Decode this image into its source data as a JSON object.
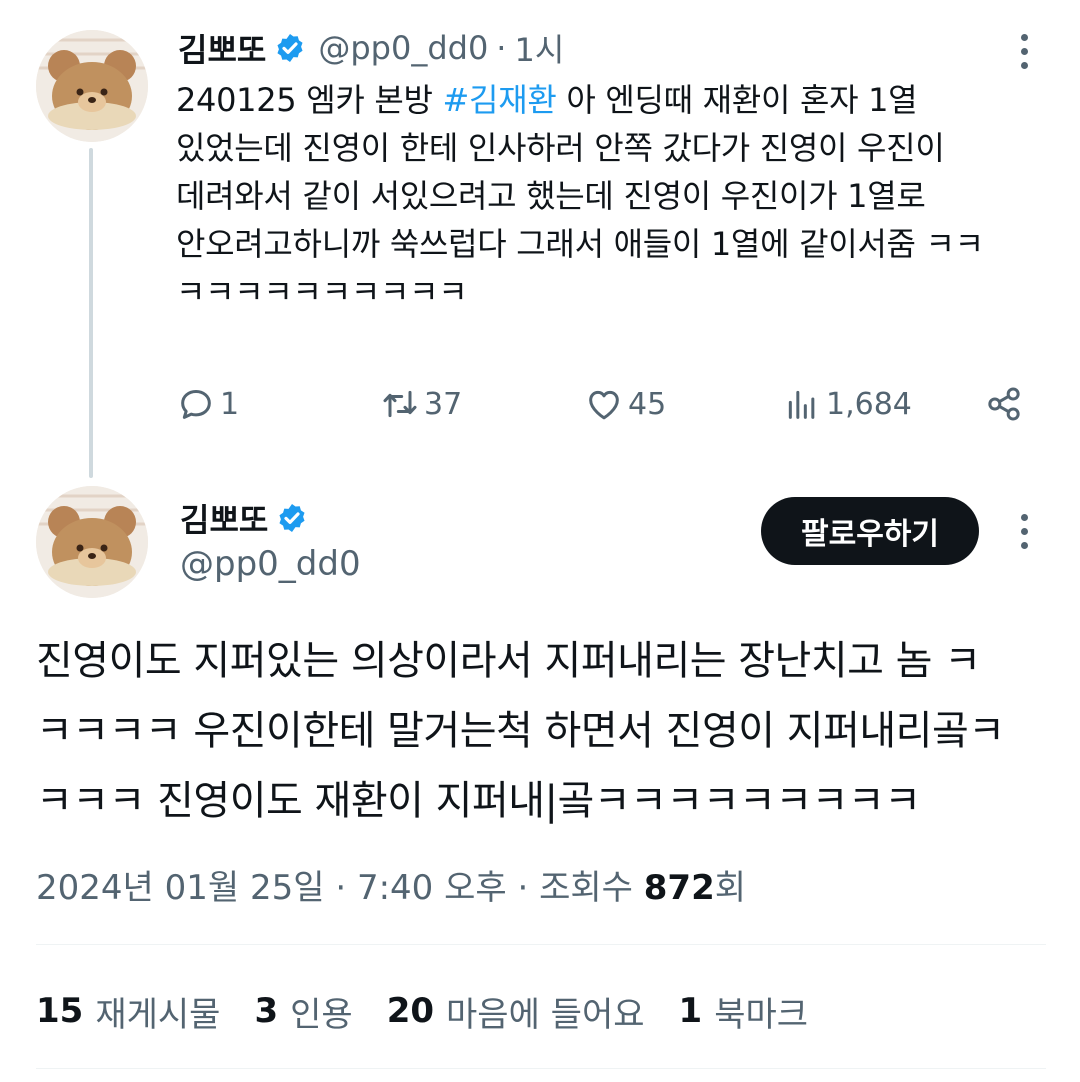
{
  "tweet1": {
    "author_name": "김뽀또",
    "handle": "@pp0_dd0",
    "time": "1시",
    "text_lines": [
      "아 엔딩때 재환이 혼자 1열",
      "있었는데 진영이 한테 인사하러 안쪽 갔다가 진영이 우진이",
      "데려와서 같이 서있으려고 했는데 진영이 우진이가 1열로",
      "안오려고하니까 쑥쓰럽다 그래서 애들이 1열에 같이서줌 ㅋㅋ",
      "ㅋㅋㅋㅋㅋㅋㅋㅋㅋㅋ"
    ],
    "text_prefix": "240125 엠카 본방 ",
    "hashtag": "#김재환",
    "replies": "1",
    "retweets": "37",
    "likes": "45",
    "views": "1,684"
  },
  "tweet2": {
    "author_name": "김뽀또",
    "handle": "@pp0_dd0",
    "follow_label": "팔로우하기",
    "text_lines": [
      "진영이도 지퍼있는 의상이라서 지퍼내리는 장난치고 놈 ㅋ",
      "ㅋㅋㅋㅋ 우진이한테 말거는척 하면서 진영이 지퍼내리곸ㅋ",
      "ㅋㅋㅋ 진영이도 재환이 지퍼내|곸ㅋㅋㅋㅋㅋㅋㅋㅋㅋ"
    ],
    "date": "2024년 01월 25일",
    "clock": "7:40 오후",
    "views_label": "조회수",
    "views_count": "872",
    "views_suffix": "회",
    "stats": [
      {
        "num": "15",
        "label": "재게시물"
      },
      {
        "num": "3",
        "label": "인용"
      },
      {
        "num": "20",
        "label": "마음에 들어요"
      },
      {
        "num": "1",
        "label": "북마크"
      }
    ]
  },
  "colors": {
    "text": "#0f1419",
    "secondary": "#536471",
    "accent": "#1d9bf0",
    "follow_bg": "#0f1419"
  },
  "icons": [
    "more-icon",
    "verified-badge-icon",
    "reply-icon",
    "retweet-icon",
    "like-icon",
    "views-icon",
    "share-icon"
  ]
}
